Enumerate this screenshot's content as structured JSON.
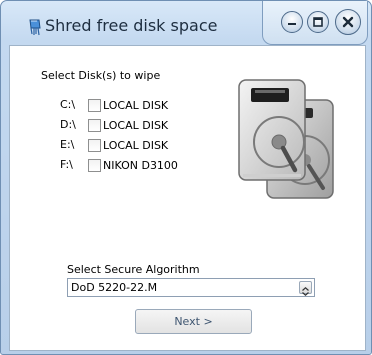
{
  "window": {
    "title": "Shred free disk space",
    "app_icon": "shredder-app-icon",
    "controls": [
      "minimize-icon",
      "maximize-icon",
      "close-icon"
    ]
  },
  "disks": {
    "heading": "Select Disk(s) to wipe",
    "items": [
      {
        "letter": "C:\\",
        "name": "LOCAL DISK",
        "checked": false
      },
      {
        "letter": "D:\\",
        "name": "LOCAL DISK",
        "checked": false
      },
      {
        "letter": "E:\\",
        "name": "LOCAL DISK",
        "checked": false
      },
      {
        "letter": "F:\\",
        "name": "NIKON D3100",
        "checked": false
      }
    ],
    "illustration": "hard-disk-icon"
  },
  "algorithm": {
    "label": "Select Secure Algorithm",
    "selected": "DoD 5220-22.M"
  },
  "buttons": {
    "next": "Next >"
  },
  "colors": {
    "frame": "#c4d9f0",
    "button_text": "#3e5570"
  }
}
